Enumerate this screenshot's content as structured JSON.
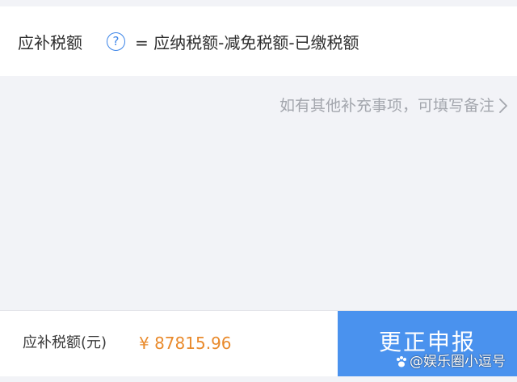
{
  "formula": {
    "label": "应补税额",
    "help_glyph": "?",
    "expression": "= 应纳税额-减免税额-已缴税额"
  },
  "note": {
    "link_text": "如有其他补充事项，可填写备注"
  },
  "footer": {
    "label": "应补税额(元)",
    "amount": "¥ 87815.96",
    "submit_label": "更正申报"
  },
  "watermark": {
    "text": "@娱乐圈小逗号"
  },
  "colors": {
    "accent_blue": "#4a92ee",
    "amount_orange": "#e98a2c",
    "muted_text": "#a3a6ad"
  }
}
